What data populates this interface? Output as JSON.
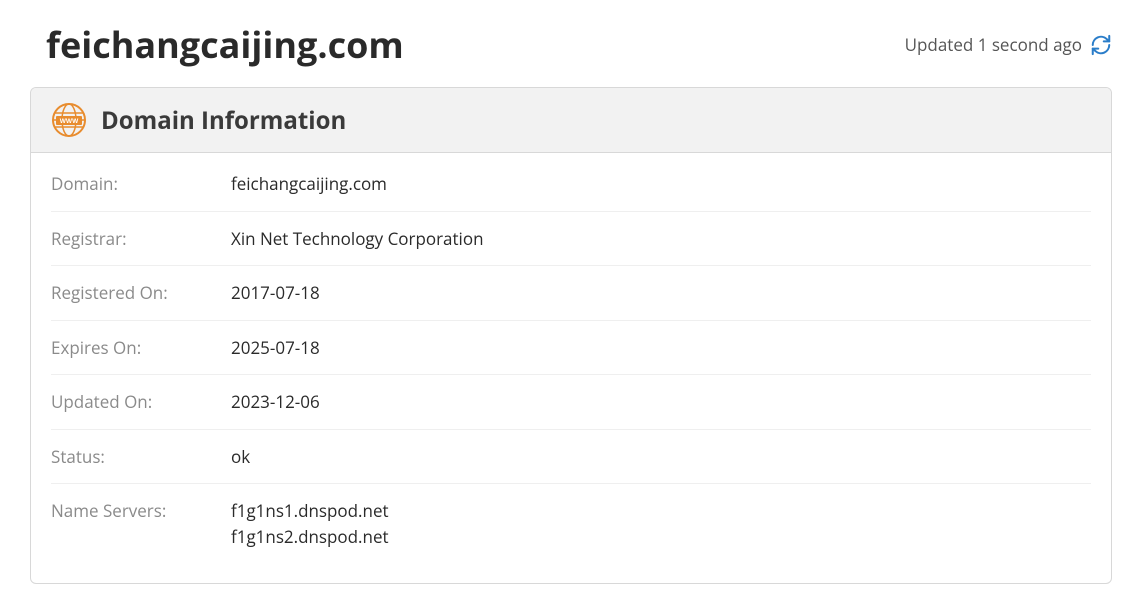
{
  "header": {
    "domain_title": "feichangcaijing.com",
    "updated_text": "Updated 1 second ago"
  },
  "card": {
    "title": "Domain Information",
    "rows": [
      {
        "label": "Domain:",
        "value": "feichangcaijing.com"
      },
      {
        "label": "Registrar:",
        "value": "Xin Net Technology Corporation"
      },
      {
        "label": "Registered On:",
        "value": "2017-07-18"
      },
      {
        "label": "Expires On:",
        "value": "2025-07-18"
      },
      {
        "label": "Updated On:",
        "value": "2023-12-06"
      },
      {
        "label": "Status:",
        "value": "ok"
      },
      {
        "label": "Name Servers:",
        "value": "f1g1ns1.dnspod.net\nf1g1ns2.dnspod.net"
      }
    ]
  }
}
